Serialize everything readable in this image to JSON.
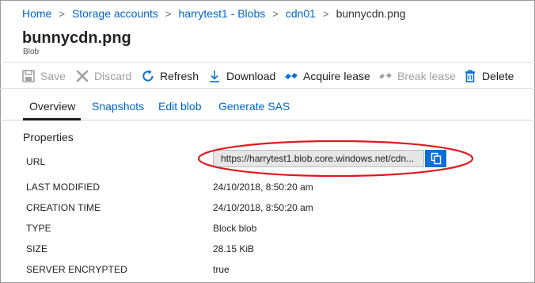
{
  "breadcrumb": {
    "items": [
      "Home",
      "Storage accounts",
      "harrytest1 - Blobs",
      "cdn01",
      "bunnycdn.png"
    ],
    "separator": ">"
  },
  "blade": {
    "title": "bunnycdn.png",
    "subtitle": "Blob"
  },
  "toolbar": {
    "save": {
      "label": "Save",
      "icon": "save-icon",
      "enabled": false
    },
    "discard": {
      "label": "Discard",
      "icon": "close-icon",
      "enabled": false
    },
    "refresh": {
      "label": "Refresh",
      "icon": "refresh-icon",
      "enabled": true
    },
    "download": {
      "label": "Download",
      "icon": "download-icon",
      "enabled": true
    },
    "acquire_lease": {
      "label": "Acquire lease",
      "icon": "lease-icon",
      "enabled": true
    },
    "break_lease": {
      "label": "Break lease",
      "icon": "break-lease-icon",
      "enabled": false
    },
    "delete": {
      "label": "Delete",
      "icon": "trash-icon",
      "enabled": true
    }
  },
  "tabs": [
    {
      "label": "Overview",
      "active": true
    },
    {
      "label": "Snapshots",
      "active": false
    },
    {
      "label": "Edit blob",
      "active": false
    },
    {
      "label": "Generate SAS",
      "active": false
    }
  ],
  "properties": {
    "heading": "Properties",
    "url_label": "URL",
    "url_value": "https://harrytest1.blob.core.windows.net/cdn...",
    "rows": [
      {
        "label": "LAST MODIFIED",
        "value": "24/10/2018, 8:50:20 am"
      },
      {
        "label": "CREATION TIME",
        "value": "24/10/2018, 8:50:20 am"
      },
      {
        "label": "TYPE",
        "value": "Block blob"
      },
      {
        "label": "SIZE",
        "value": "28.15 KiB"
      },
      {
        "label": "SERVER ENCRYPTED",
        "value": "true"
      }
    ]
  },
  "colors": {
    "link": "#0066c7",
    "accent": "#0b6fd6",
    "annotation": "#e0191f",
    "disabled": "#a0a0a0"
  }
}
